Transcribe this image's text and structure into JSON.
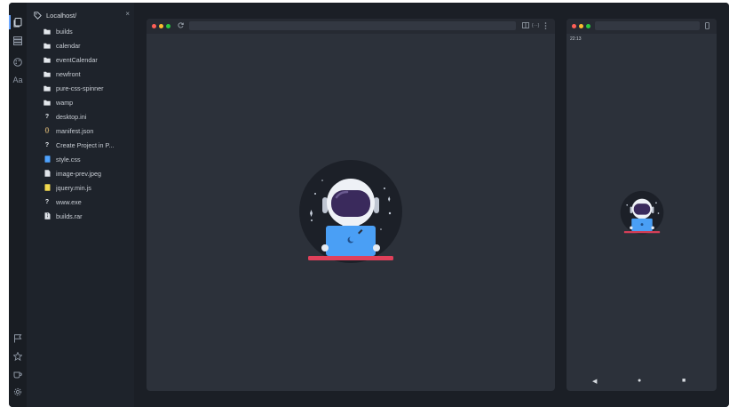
{
  "sidebar": {
    "title": "Localhost/",
    "close_glyph": "×",
    "items": [
      {
        "label": "builds",
        "icon": "folder-icon"
      },
      {
        "label": "calendar",
        "icon": "folder-icon"
      },
      {
        "label": "eventCalendar",
        "icon": "folder-icon"
      },
      {
        "label": "newfront",
        "icon": "folder-icon"
      },
      {
        "label": "pure-css-spinner",
        "icon": "folder-icon"
      },
      {
        "label": "wamp",
        "icon": "folder-icon"
      },
      {
        "label": "desktop.ini",
        "icon": "unknown-file-icon"
      },
      {
        "label": "manifest.json",
        "icon": "json-file-icon"
      },
      {
        "label": "Create Project in P...",
        "icon": "unknown-file-icon"
      },
      {
        "label": "style.css",
        "icon": "css-file-icon"
      },
      {
        "label": "image-prev.jpeg",
        "icon": "image-file-icon"
      },
      {
        "label": "jquery.min.js",
        "icon": "js-file-icon"
      },
      {
        "label": "www.exe",
        "icon": "unknown-file-icon"
      },
      {
        "label": "builds.rar",
        "icon": "archive-file-icon"
      }
    ]
  },
  "activity_bar": {
    "top": [
      "files-icon",
      "layers-icon",
      "palette-icon",
      "font-icon"
    ],
    "font_label": "Aa",
    "bottom": [
      "flag-icon",
      "star-icon",
      "coffee-icon",
      "gear-icon"
    ]
  },
  "desktop_preview": {
    "url": "",
    "traffic_lights": [
      "#ff5f57",
      "#febc2e",
      "#28c840"
    ],
    "tool_label": "{···}"
  },
  "mobile_preview": {
    "url": "",
    "time": "22:13",
    "traffic_lights": [
      "#ff5f57",
      "#febc2e",
      "#28c840"
    ],
    "nav": {
      "back": "◀",
      "home": "●",
      "recent": "■"
    }
  },
  "colors": {
    "background": "#1b1f26",
    "panel": "#2c313a",
    "accent": "#6ea8ff",
    "laptop": "#4a9ff5",
    "desk": "#e0405a"
  }
}
